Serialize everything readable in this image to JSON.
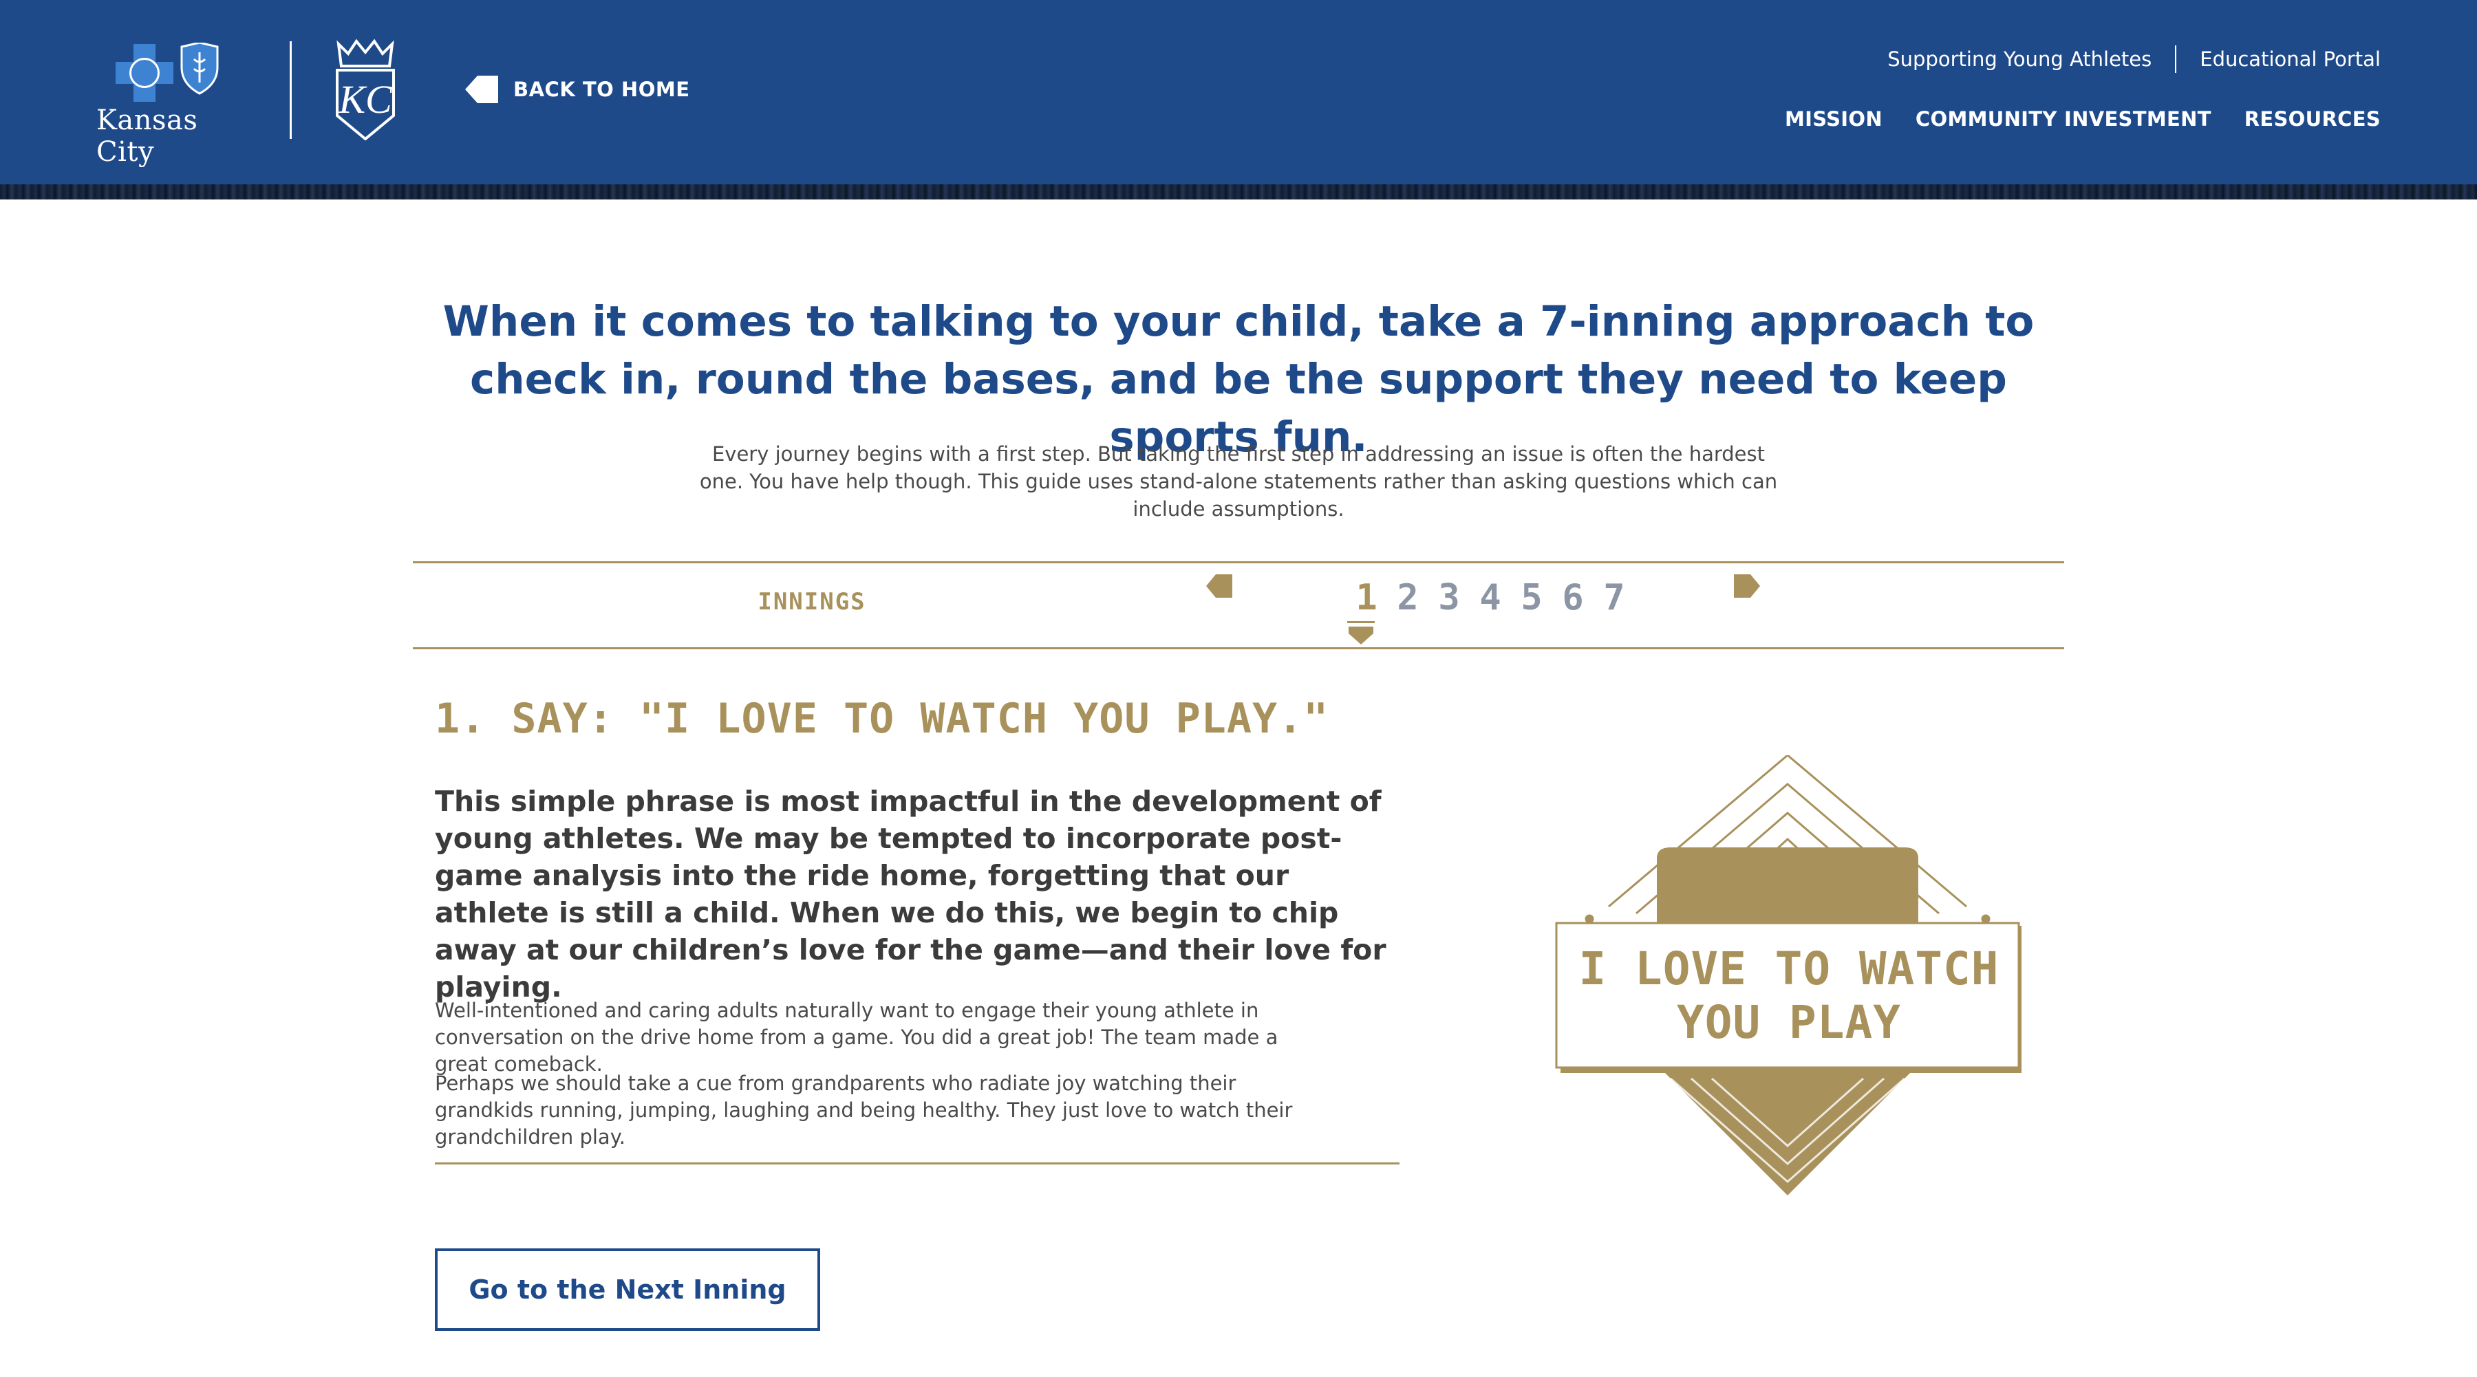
{
  "header": {
    "brand_text": "Kansas City",
    "back_label": "BACK TO HOME",
    "util_nav": [
      "Supporting Young Athletes",
      "Educational Portal"
    ],
    "main_nav": [
      "MISSION",
      "COMMUNITY INVESTMENT",
      "RESOURCES"
    ]
  },
  "intro": {
    "headline": "When it comes to talking to your child, take a 7-inning approach to check in, round the bases, and be the support they need to keep sports fun.",
    "body": "Every journey begins with a first step. But taking the first step in addressing an issue is often the hardest one. You have help though. This guide uses stand-alone statements rather than asking questions which can include assumptions."
  },
  "innings": {
    "label": "INNINGS",
    "numbers": [
      "1",
      "2",
      "3",
      "4",
      "5",
      "6",
      "7"
    ],
    "active": "1"
  },
  "content": {
    "title": "1. SAY: \"I LOVE TO WATCH YOU PLAY.\"",
    "lead": "This simple phrase is most impactful in the development of young athletes. We may be tempted to incorporate post-game analysis into the ride home, forgetting that our athlete is still a child. When we do this, we begin to chip away at our children’s love for the game—and their love for playing.",
    "p1": "Well-intentioned and caring adults naturally want to engage their young athlete in conversation on the drive home from a game. You did a great job! The team made a great comeback.",
    "p2": "Perhaps we should take a cue from grandparents who radiate joy watching their grandkids running, jumping, laughing and being healthy. They just love to watch their grandchildren play.",
    "next_button": "Go to the Next Inning"
  },
  "illustration": {
    "sign_text": "I LOVE TO WATCH YOU PLAY"
  },
  "colors": {
    "header_blue": "#1f4a8a",
    "gold": "#a8915a",
    "inactive_gray": "#8c95a4"
  }
}
